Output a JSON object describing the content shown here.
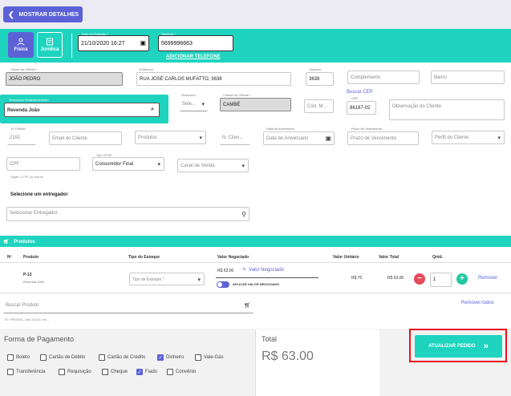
{
  "top": {
    "show_details": "MOSTRAR DETALHES"
  },
  "person_types": {
    "fisica": "Física",
    "juridica": "Jurídica"
  },
  "header": {
    "date_label": "Data de Emissão *",
    "date_value": "21/10/2020 16:27",
    "phone_label": "Telefone *",
    "phone_value": "5699996663",
    "add_phone": "ADICIONAR TELEFONE"
  },
  "client": {
    "name_label": "Nome do Cliente *",
    "name_value": "JOÃO PEDRO",
    "address_label": "Endereço",
    "address_value": "RUA JOSÉ CARLOS MUFATTO, 3638",
    "number_label": "Número",
    "number_value": "3638",
    "complement_ph": "Complemento",
    "neighborhood_ph": "Bairro"
  },
  "estab": {
    "label": "Selecionar Estabelecimento",
    "value": "Revenda João",
    "uf_label": "Selecione...",
    "uf_ph": "Sele...",
    "city_label": "Cidade do Cliente *",
    "city_value": "CAMBÉ",
    "cod_ph": "Cód. M...",
    "cep_link": "Buscar CEP",
    "cep_label": "CEP",
    "cep_value": "86187-02",
    "obs_ph": "Observação do Cliente"
  },
  "row3": {
    "pedido_label": "N. Pedido",
    "pedido_value": "2191",
    "email_ph": "Email do Cliente",
    "produtos_ph": "Produtos",
    "ncli_ph": "N. Clien...",
    "birthday_label": "Data de Aniversário",
    "birthday_ph": "Data de Aniversário",
    "due_label": "Prazo de Vencimento",
    "due_ph": "Prazo de Vencimento",
    "profile_ph": "Perfil do Cliente"
  },
  "row4": {
    "cpf_ph": "CPF",
    "cpf_hint": "Digite o CPF do cliente",
    "tipo_label": "Tipo CFOP",
    "tipo_value": "Consumidor Final",
    "canal_ph": "Canal de Venda"
  },
  "entregador": {
    "title": "Selecione um entregador",
    "ph": "Selecionar Entregador"
  },
  "products": {
    "bar_title": "Produtos",
    "headers": [
      "Nº",
      "Produto",
      "Tipo do Estoque",
      "Valor Negociado",
      "Valor Unitário",
      "Valor Total",
      "Qntd."
    ],
    "item": {
      "code": "P-13",
      "store": "Revenda João",
      "stock_ph": "Tipo de Estoque *",
      "negotiated": "R$ 63,00",
      "negotiated_link": "Valor Negociado",
      "apply_label": "APLICAR VALOR NEGOCIADO",
      "unit": "R$ 70",
      "total": "R$ 63,00",
      "qty": "1",
      "remove": "Remover"
    },
    "search_ph": "Buscar Produto",
    "search_hint": "Ex: PROD01, Gás 13 KG, etc...",
    "remove_all": "Remover todos"
  },
  "payment": {
    "title": "Forma de Pagamento",
    "options": [
      {
        "label": "Boleto",
        "checked": false
      },
      {
        "label": "Cartão de Débito",
        "checked": false
      },
      {
        "label": "Cartão de Crédito",
        "checked": false
      },
      {
        "label": "Dinheiro",
        "checked": true
      },
      {
        "label": "Vale-Gás",
        "checked": false
      },
      {
        "label": "Transferência",
        "checked": false
      },
      {
        "label": "Requisição",
        "checked": false
      },
      {
        "label": "Cheque",
        "checked": false
      },
      {
        "label": "Fiado",
        "checked": true
      },
      {
        "label": "Convênio",
        "checked": false
      }
    ]
  },
  "total": {
    "label": "Total",
    "value": "R$ 63.00"
  },
  "actions": {
    "update": "ATUALIZAR PEDIDO"
  },
  "colors": {
    "primary": "#5c62d6",
    "teal": "#1ed4bf",
    "highlight": "#e8101c"
  }
}
